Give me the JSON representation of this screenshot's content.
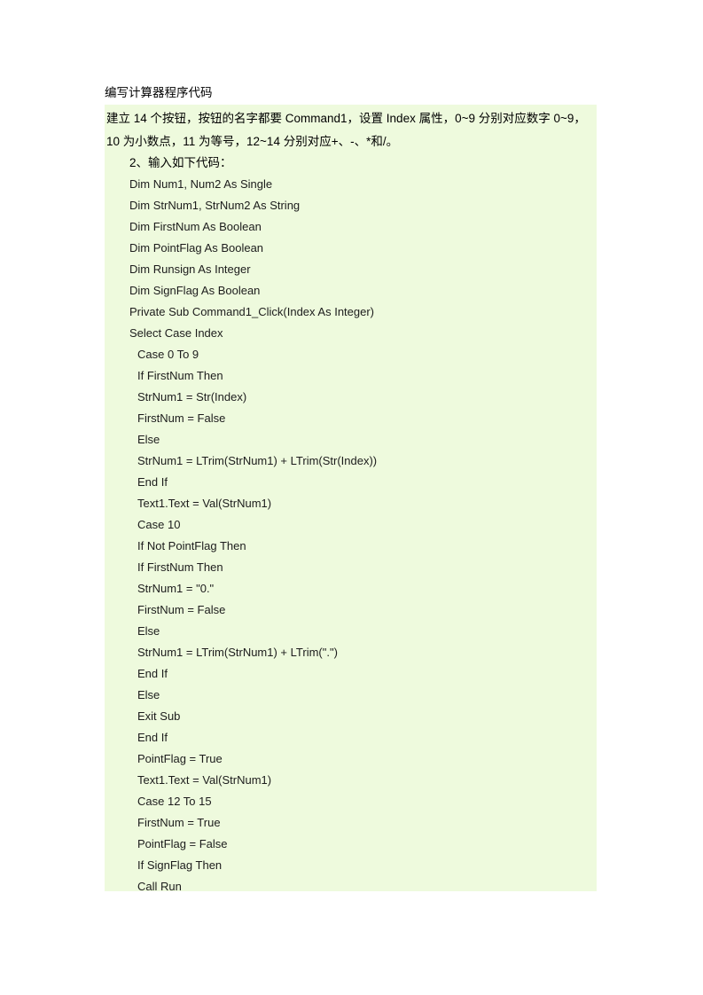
{
  "document": {
    "title": "编写计算器程序代码",
    "page_background": "#ffffff",
    "highlight_color": "#eefadd"
  },
  "intro": {
    "line1": "建立 14 个按钮，按钮的名字都要 Command1，设置 Index 属性，0~9 分别对应数字 0~9，",
    "line2": "10 为小数点，11 为等号，12~14 分别对应+、-、*和/。",
    "step": "2、输入如下代码："
  },
  "code": {
    "lines": [
      {
        "text": "Dim Num1, Num2 As Single",
        "indent": 0
      },
      {
        "text": "Dim StrNum1, StrNum2 As String",
        "indent": 0
      },
      {
        "text": "Dim FirstNum As Boolean",
        "indent": 0
      },
      {
        "text": "Dim PointFlag As Boolean",
        "indent": 0
      },
      {
        "text": "Dim Runsign As Integer",
        "indent": 0
      },
      {
        "text": "Dim SignFlag As Boolean",
        "indent": 0
      },
      {
        "text": "Private Sub Command1_Click(Index As Integer)",
        "indent": 0
      },
      {
        "text": "Select Case Index",
        "indent": 0
      },
      {
        "text": "Case 0 To 9",
        "indent": 1
      },
      {
        "text": "If FirstNum Then",
        "indent": 1
      },
      {
        "text": "StrNum1 = Str(Index)",
        "indent": 1
      },
      {
        "text": "FirstNum = False",
        "indent": 1
      },
      {
        "text": "Else",
        "indent": 1
      },
      {
        "text": "StrNum1 = LTrim(StrNum1) + LTrim(Str(Index))",
        "indent": 1
      },
      {
        "text": "End If",
        "indent": 1
      },
      {
        "text": "Text1.Text = Val(StrNum1)",
        "indent": 1
      },
      {
        "text": "Case 10",
        "indent": 1
      },
      {
        "text": "If Not PointFlag Then",
        "indent": 1
      },
      {
        "text": "If FirstNum Then",
        "indent": 1
      },
      {
        "text": "StrNum1 = \"0.\"",
        "indent": 1
      },
      {
        "text": "FirstNum = False",
        "indent": 1
      },
      {
        "text": "Else",
        "indent": 1
      },
      {
        "text": "StrNum1 = LTrim(StrNum1) + LTrim(\".\")",
        "indent": 1
      },
      {
        "text": "End If",
        "indent": 1
      },
      {
        "text": "Else",
        "indent": 1
      },
      {
        "text": "Exit Sub",
        "indent": 1
      },
      {
        "text": "End If",
        "indent": 1
      },
      {
        "text": "PointFlag = True",
        "indent": 1
      },
      {
        "text": "Text1.Text = Val(StrNum1)",
        "indent": 1
      },
      {
        "text": "Case 12 To 15",
        "indent": 1
      },
      {
        "text": "FirstNum = True",
        "indent": 1
      },
      {
        "text": "PointFlag = False",
        "indent": 1
      },
      {
        "text": "If SignFlag Then",
        "indent": 1
      },
      {
        "text": "Call Run",
        "indent": 1
      }
    ]
  }
}
